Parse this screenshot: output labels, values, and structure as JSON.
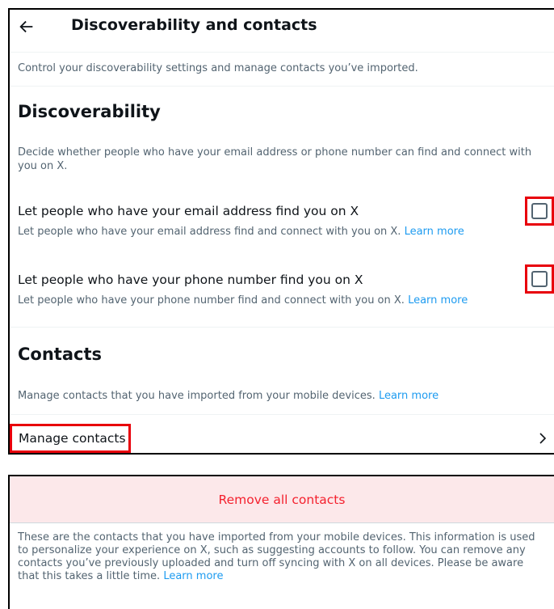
{
  "header": {
    "title": "Discoverability and contacts",
    "back_icon": "arrow-left-icon"
  },
  "intro": "Control your discoverability settings and manage contacts you’ve imported.",
  "discoverability": {
    "heading": "Discoverability",
    "description": "Decide whether people who have your email address or phone number can find and connect with you on X.",
    "options": [
      {
        "title": "Let people who have your email address find you on X",
        "subtitle": "Let people who have your email address find and connect with you on X.",
        "link": "Learn more",
        "checked": false
      },
      {
        "title": "Let people who have your phone number find you on X",
        "subtitle": "Let people who have your phone number find and connect with you on X.",
        "link": "Learn more",
        "checked": false
      }
    ]
  },
  "contacts": {
    "heading": "Contacts",
    "description": "Manage contacts that you have imported from your mobile devices.",
    "link": "Learn more",
    "manage_label": "Manage contacts",
    "chevron_icon": "chevron-right-icon"
  },
  "remove_panel": {
    "button_label": "Remove all contacts",
    "description": "These are the contacts that you have imported from your mobile devices. This information is used to personalize your experience on X, such as suggesting accounts to follow. You can remove any contacts you’ve previously uploaded and turn off syncing with X on all devices. Please be aware that this takes a little time.",
    "link": "Learn more"
  },
  "colors": {
    "accent_link": "#1d9bf0",
    "danger": "#f4212e",
    "danger_bg": "#fce8ea",
    "highlight_box": "#e8000b",
    "muted_text": "#536471"
  }
}
